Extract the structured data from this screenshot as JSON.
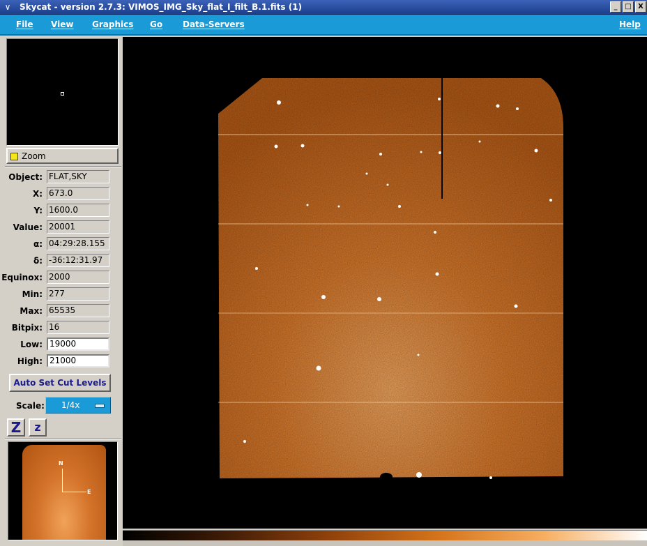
{
  "window": {
    "title": "Skycat - version 2.7.3: VIMOS_IMG_Sky_flat_I_filt_B.1.fits (1)",
    "controls": {
      "minimize": "_",
      "maximize": "□",
      "close": "X"
    }
  },
  "menubar": {
    "items": [
      "File",
      "View",
      "Graphics",
      "Go",
      "Data-Servers"
    ],
    "help": "Help"
  },
  "zoom": {
    "label": "Zoom"
  },
  "info": {
    "object": {
      "label": "Object:",
      "value": "FLAT,SKY"
    },
    "x": {
      "label": "X:",
      "value": "673.0"
    },
    "y": {
      "label": "Y:",
      "value": "1600.0"
    },
    "value": {
      "label": "Value:",
      "value": "20001"
    },
    "ra": {
      "label": "α:",
      "value": "04:29:28.155"
    },
    "dec": {
      "label": "δ:",
      "value": "-36:12:31.97"
    },
    "equinox": {
      "label": "Equinox:",
      "value": "2000"
    },
    "min": {
      "label": "Min:",
      "value": "277"
    },
    "max": {
      "label": "Max:",
      "value": "65535"
    },
    "bitpix": {
      "label": "Bitpix:",
      "value": "16"
    },
    "low": {
      "label": "Low:",
      "value": "19000"
    },
    "high": {
      "label": "High:",
      "value": "21000"
    }
  },
  "buttons": {
    "auto_cut": "Auto Set Cut Levels",
    "zoom_in": "Z",
    "zoom_out": "z"
  },
  "scale": {
    "label": "Scale:",
    "value": "1/4x"
  },
  "compass": {
    "north": "N",
    "east": "E"
  },
  "colors": {
    "menubar": "#1a9ad6",
    "titlebar": "#2a4d9c",
    "image_orange": "#d4732a",
    "panel": "#d4d0c8"
  }
}
